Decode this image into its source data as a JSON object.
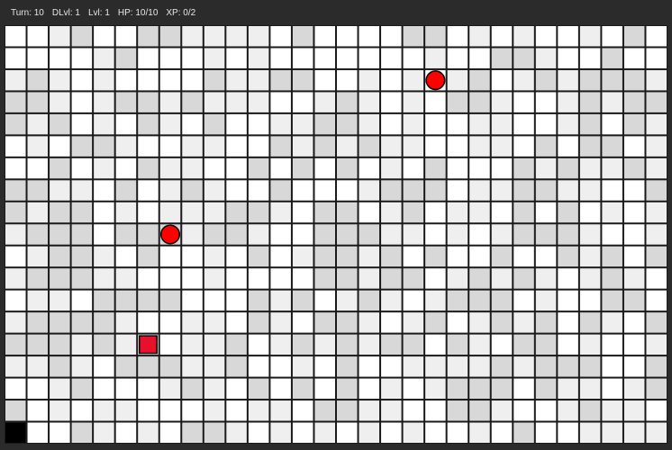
{
  "status": {
    "turn": "Turn: 10",
    "dungeon_level": "DLvl: 1",
    "level": "Lvl: 1",
    "hp": "HP: 10/10",
    "xp": "XP: 0/2"
  },
  "colors": {
    "background": "#2b2b2b",
    "text": "#e6e6e6",
    "grid_line": "#1a1a1a",
    "floor_white": "#ffffff",
    "floor_light": "#efefef",
    "floor_gray": "#d8d8d8",
    "enemy": "#ff0000",
    "player": "#e8102a",
    "stairs": "#000000"
  },
  "map": {
    "cols": 30,
    "rows": 19,
    "tiles": [
      "001200221111020000220101001020",
      "000012000101000000010022100200",
      "121010000211220010101201212221",
      "221012212111001210102210012122",
      "212010210200112210100110012021",
      "010221001100212121100110202201",
      "002010211002020201020002121121",
      "221102012100200012220112211002",
      "212201011122102201201102020101",
      "122202221221002221101012221001",
      "012210200102012212020020021202",
      "122211000100002212201212101210",
      "011022220002120121012220100220",
      "122221001102102210120121202102",
      "222121001120121212202102201001",
      "112102221120010200111121222002",
      "001200012102020201012220211012",
      "201011000101102211002210012110",
      "100210102210101010100102001111"
    ],
    "enemies": [
      {
        "name": "enemy",
        "col": 19,
        "row": 2
      },
      {
        "name": "enemy",
        "col": 7,
        "row": 9
      }
    ],
    "player": {
      "col": 6,
      "row": 14
    },
    "stairs": {
      "col": 0,
      "row": 18
    }
  }
}
